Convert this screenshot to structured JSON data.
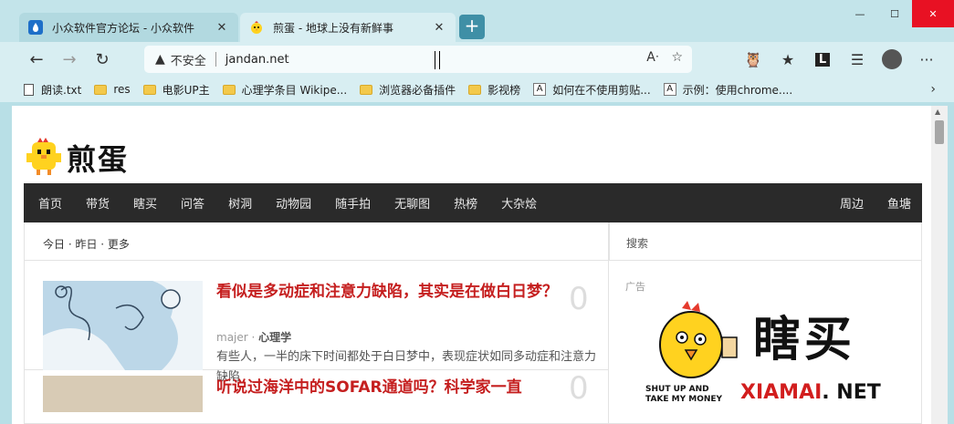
{
  "tabs": [
    {
      "title": "小众软件官方论坛 - 小众软件",
      "icon": "droplet-icon",
      "active": false
    },
    {
      "title": "煎蛋 - 地球上没有新鲜事",
      "icon": "chick-icon",
      "active": true
    }
  ],
  "toolbar": {
    "security": "不安全",
    "url": "jandan.net"
  },
  "bookmarks": [
    {
      "label": "朗读.txt",
      "type": "doc"
    },
    {
      "label": "res",
      "type": "folder"
    },
    {
      "label": "电影UP主",
      "type": "folder"
    },
    {
      "label": "心理学条目 Wikipe...",
      "type": "folder"
    },
    {
      "label": "浏览器必备插件",
      "type": "folder"
    },
    {
      "label": "影视榜",
      "type": "folder"
    },
    {
      "label": "如何在不使用剪贴...",
      "type": "page"
    },
    {
      "label": "示例：使用chrome....",
      "type": "page"
    }
  ],
  "site": {
    "logo_text": "煎蛋",
    "nav": [
      "首页",
      "带货",
      "瞎买",
      "问答",
      "树洞",
      "动物园",
      "随手拍",
      "无聊图",
      "热榜",
      "大杂烩"
    ],
    "nav_right": [
      "周边",
      "鱼塘"
    ],
    "left_header": "今日 · 昨日 · 更多",
    "right_header": "搜索",
    "ad_label": "广告",
    "ad_big": "瞎买",
    "ad_domain_a": "XIAMAI",
    "ad_domain_b": ". NET",
    "ad_slogan": "SHUT UP AND TAKE MY MONEY"
  },
  "posts": [
    {
      "title": "看似是多动症和注意力缺陷，其实是在做白日梦？",
      "count": "0",
      "author": "majer",
      "category": "心理学",
      "desc": "有些人，一半的床下时间都处于白日梦中，表现症状如同多动症和注意力缺陷"
    },
    {
      "title": "听说过海洋中的SOFAR通道吗？科学家一直",
      "count": "0"
    }
  ]
}
